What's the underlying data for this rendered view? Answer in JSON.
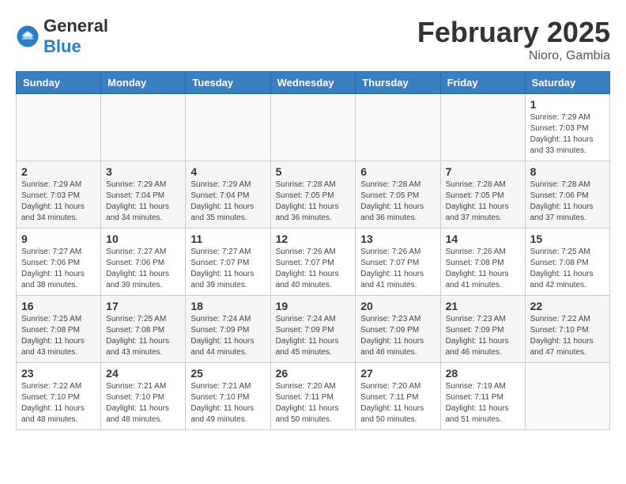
{
  "header": {
    "logo_general": "General",
    "logo_blue": "Blue",
    "month_title": "February 2025",
    "location": "Nioro, Gambia"
  },
  "days_of_week": [
    "Sunday",
    "Monday",
    "Tuesday",
    "Wednesday",
    "Thursday",
    "Friday",
    "Saturday"
  ],
  "weeks": [
    [
      {
        "day": "",
        "info": ""
      },
      {
        "day": "",
        "info": ""
      },
      {
        "day": "",
        "info": ""
      },
      {
        "day": "",
        "info": ""
      },
      {
        "day": "",
        "info": ""
      },
      {
        "day": "",
        "info": ""
      },
      {
        "day": "1",
        "info": "Sunrise: 7:29 AM\nSunset: 7:03 PM\nDaylight: 11 hours\nand 33 minutes."
      }
    ],
    [
      {
        "day": "2",
        "info": "Sunrise: 7:29 AM\nSunset: 7:03 PM\nDaylight: 11 hours\nand 34 minutes."
      },
      {
        "day": "3",
        "info": "Sunrise: 7:29 AM\nSunset: 7:04 PM\nDaylight: 11 hours\nand 34 minutes."
      },
      {
        "day": "4",
        "info": "Sunrise: 7:29 AM\nSunset: 7:04 PM\nDaylight: 11 hours\nand 35 minutes."
      },
      {
        "day": "5",
        "info": "Sunrise: 7:28 AM\nSunset: 7:05 PM\nDaylight: 11 hours\nand 36 minutes."
      },
      {
        "day": "6",
        "info": "Sunrise: 7:28 AM\nSunset: 7:05 PM\nDaylight: 11 hours\nand 36 minutes."
      },
      {
        "day": "7",
        "info": "Sunrise: 7:28 AM\nSunset: 7:05 PM\nDaylight: 11 hours\nand 37 minutes."
      },
      {
        "day": "8",
        "info": "Sunrise: 7:28 AM\nSunset: 7:06 PM\nDaylight: 11 hours\nand 37 minutes."
      }
    ],
    [
      {
        "day": "9",
        "info": "Sunrise: 7:27 AM\nSunset: 7:06 PM\nDaylight: 11 hours\nand 38 minutes."
      },
      {
        "day": "10",
        "info": "Sunrise: 7:27 AM\nSunset: 7:06 PM\nDaylight: 11 hours\nand 39 minutes."
      },
      {
        "day": "11",
        "info": "Sunrise: 7:27 AM\nSunset: 7:07 PM\nDaylight: 11 hours\nand 39 minutes."
      },
      {
        "day": "12",
        "info": "Sunrise: 7:26 AM\nSunset: 7:07 PM\nDaylight: 11 hours\nand 40 minutes."
      },
      {
        "day": "13",
        "info": "Sunrise: 7:26 AM\nSunset: 7:07 PM\nDaylight: 11 hours\nand 41 minutes."
      },
      {
        "day": "14",
        "info": "Sunrise: 7:26 AM\nSunset: 7:08 PM\nDaylight: 11 hours\nand 41 minutes."
      },
      {
        "day": "15",
        "info": "Sunrise: 7:25 AM\nSunset: 7:08 PM\nDaylight: 11 hours\nand 42 minutes."
      }
    ],
    [
      {
        "day": "16",
        "info": "Sunrise: 7:25 AM\nSunset: 7:08 PM\nDaylight: 11 hours\nand 43 minutes."
      },
      {
        "day": "17",
        "info": "Sunrise: 7:25 AM\nSunset: 7:08 PM\nDaylight: 11 hours\nand 43 minutes."
      },
      {
        "day": "18",
        "info": "Sunrise: 7:24 AM\nSunset: 7:09 PM\nDaylight: 11 hours\nand 44 minutes."
      },
      {
        "day": "19",
        "info": "Sunrise: 7:24 AM\nSunset: 7:09 PM\nDaylight: 11 hours\nand 45 minutes."
      },
      {
        "day": "20",
        "info": "Sunrise: 7:23 AM\nSunset: 7:09 PM\nDaylight: 11 hours\nand 46 minutes."
      },
      {
        "day": "21",
        "info": "Sunrise: 7:23 AM\nSunset: 7:09 PM\nDaylight: 11 hours\nand 46 minutes."
      },
      {
        "day": "22",
        "info": "Sunrise: 7:22 AM\nSunset: 7:10 PM\nDaylight: 11 hours\nand 47 minutes."
      }
    ],
    [
      {
        "day": "23",
        "info": "Sunrise: 7:22 AM\nSunset: 7:10 PM\nDaylight: 11 hours\nand 48 minutes."
      },
      {
        "day": "24",
        "info": "Sunrise: 7:21 AM\nSunset: 7:10 PM\nDaylight: 11 hours\nand 48 minutes."
      },
      {
        "day": "25",
        "info": "Sunrise: 7:21 AM\nSunset: 7:10 PM\nDaylight: 11 hours\nand 49 minutes."
      },
      {
        "day": "26",
        "info": "Sunrise: 7:20 AM\nSunset: 7:11 PM\nDaylight: 11 hours\nand 50 minutes."
      },
      {
        "day": "27",
        "info": "Sunrise: 7:20 AM\nSunset: 7:11 PM\nDaylight: 11 hours\nand 50 minutes."
      },
      {
        "day": "28",
        "info": "Sunrise: 7:19 AM\nSunset: 7:11 PM\nDaylight: 11 hours\nand 51 minutes."
      },
      {
        "day": "",
        "info": ""
      }
    ]
  ]
}
